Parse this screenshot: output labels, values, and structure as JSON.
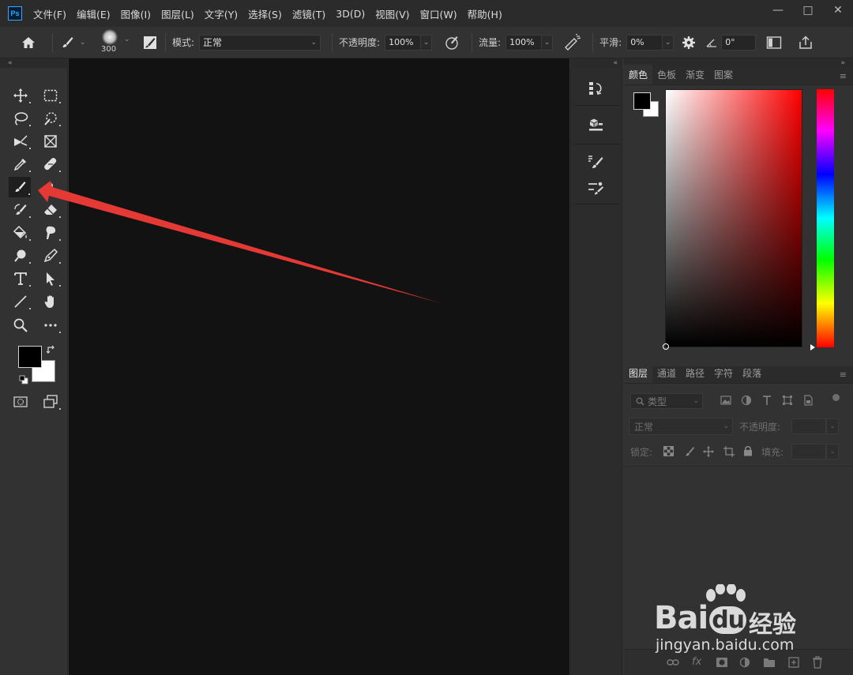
{
  "app": {
    "logo": "Ps"
  },
  "menu": [
    "文件(F)",
    "编辑(E)",
    "图像(I)",
    "图层(L)",
    "文字(Y)",
    "选择(S)",
    "滤镜(T)",
    "3D(D)",
    "视图(V)",
    "窗口(W)",
    "帮助(H)"
  ],
  "window_controls": {
    "minimize": "—",
    "maximize": "□",
    "close": "✕"
  },
  "options": {
    "brush_size": "300",
    "mode_label": "模式:",
    "mode_value": "正常",
    "opacity_label": "不透明度:",
    "opacity_value": "100%",
    "flow_label": "流量:",
    "flow_value": "100%",
    "smooth_label": "平滑:",
    "smooth_value": "0%",
    "angle_value": "0°"
  },
  "collapse": {
    "left": "«",
    "right": "»"
  },
  "color_panel": {
    "tabs": [
      "颜色",
      "色板",
      "渐变",
      "图案"
    ],
    "foreground": "#000000",
    "background": "#ffffff",
    "hue": "#ff0000"
  },
  "layers_panel": {
    "tabs": [
      "图层",
      "通道",
      "路径",
      "字符",
      "段落"
    ],
    "filter_label": "类型",
    "blend_mode": "正常",
    "opacity_label": "不透明度:",
    "lock_label": "锁定:",
    "fill_label": "填充:",
    "fx_label": "fx"
  },
  "annotation": {
    "arrow_color": "#e53935"
  },
  "watermark": {
    "brand": "Bai",
    "brand2": "du",
    "cn": "经验",
    "url": "jingyan.baidu.com"
  }
}
